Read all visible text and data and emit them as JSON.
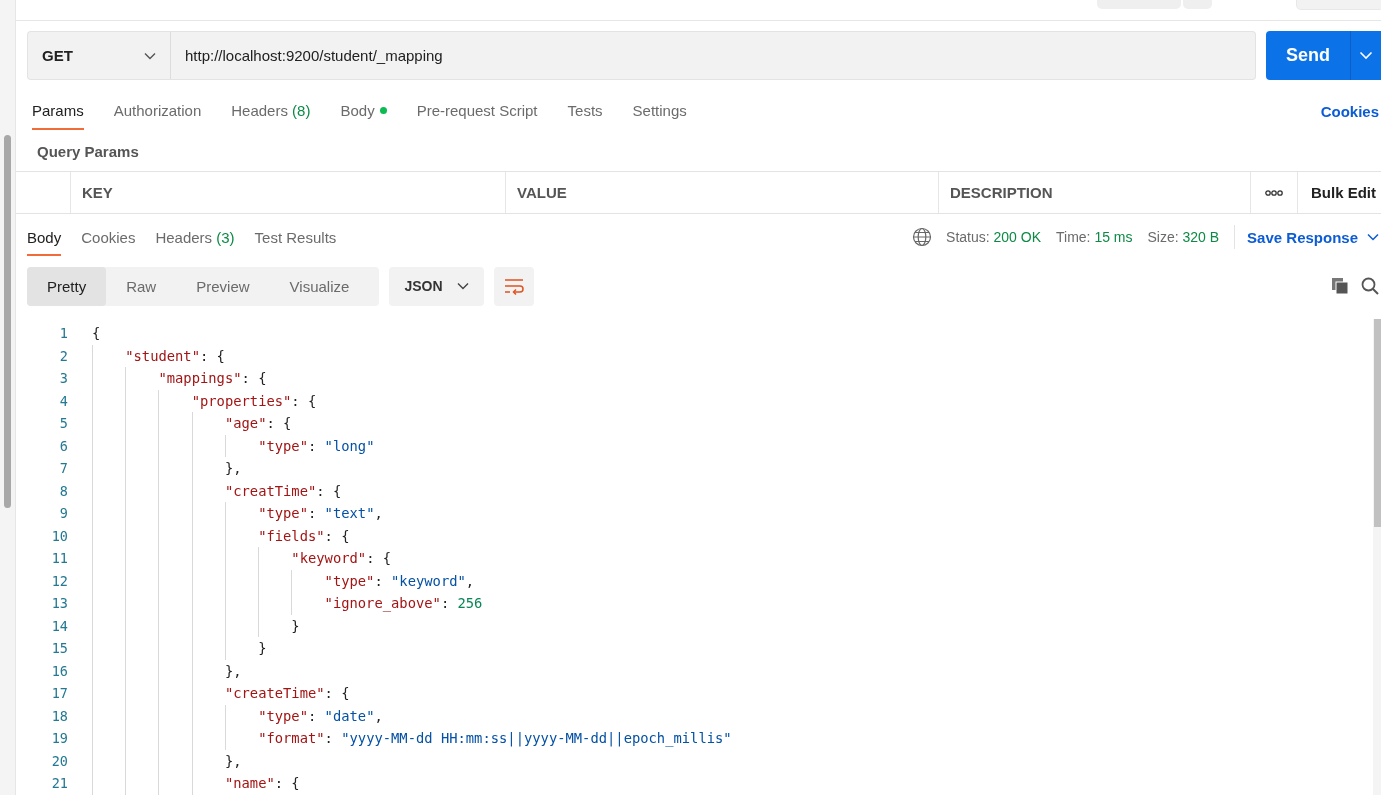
{
  "request": {
    "method": "GET",
    "url": "http://localhost:9200/student/_mapping",
    "send": "Send"
  },
  "request_tabs": [
    {
      "label": "Params",
      "selected": true
    },
    {
      "label": "Authorization",
      "selected": false
    },
    {
      "label": "Headers",
      "count": "(8)",
      "selected": false
    },
    {
      "label": "Body",
      "dot": true,
      "selected": false
    },
    {
      "label": "Pre-request Script",
      "selected": false
    },
    {
      "label": "Tests",
      "selected": false
    },
    {
      "label": "Settings",
      "selected": false
    }
  ],
  "cookies_link": "Cookies",
  "query_params": {
    "title": "Query Params",
    "columns": [
      "KEY",
      "VALUE",
      "DESCRIPTION"
    ],
    "bulk_edit": "Bulk Edit"
  },
  "response_tabs": [
    {
      "label": "Body",
      "selected": true
    },
    {
      "label": "Cookies",
      "selected": false
    },
    {
      "label": "Headers",
      "count": "(3)",
      "selected": false
    },
    {
      "label": "Test Results",
      "selected": false
    }
  ],
  "response_meta": [
    {
      "label": "Status:",
      "value": "200 OK"
    },
    {
      "label": "Time:",
      "value": "15 ms"
    },
    {
      "label": "Size:",
      "value": "320 B"
    }
  ],
  "save_response": "Save Response",
  "view_modes": [
    {
      "label": "Pretty",
      "selected": true
    },
    {
      "label": "Raw",
      "selected": false
    },
    {
      "label": "Preview",
      "selected": false
    },
    {
      "label": "Visualize",
      "selected": false
    }
  ],
  "format": "JSON",
  "code": [
    {
      "number": "1",
      "tokens": [
        {
          "kind": "punct",
          "text": "{"
        }
      ]
    },
    {
      "number": "2",
      "tokens": [
        {
          "kind": "key",
          "text": "    \"student\""
        },
        {
          "kind": "punct",
          "text": ": {"
        }
      ]
    },
    {
      "number": "3",
      "tokens": [
        {
          "kind": "key",
          "text": "        \"mappings\""
        },
        {
          "kind": "punct",
          "text": ": {"
        }
      ]
    },
    {
      "number": "4",
      "tokens": [
        {
          "kind": "key",
          "text": "            \"properties\""
        },
        {
          "kind": "punct",
          "text": ": {"
        }
      ]
    },
    {
      "number": "5",
      "tokens": [
        {
          "kind": "key",
          "text": "                \"age\""
        },
        {
          "kind": "punct",
          "text": ": {"
        }
      ]
    },
    {
      "number": "6",
      "tokens": [
        {
          "kind": "key",
          "text": "                    \"type\""
        },
        {
          "kind": "punct",
          "text": ": "
        },
        {
          "kind": "string",
          "text": "\"long\""
        }
      ]
    },
    {
      "number": "7",
      "tokens": [
        {
          "kind": "punct",
          "text": "                },"
        }
      ]
    },
    {
      "number": "8",
      "tokens": [
        {
          "kind": "key",
          "text": "                \"creatTime\""
        },
        {
          "kind": "punct",
          "text": ": {"
        }
      ]
    },
    {
      "number": "9",
      "tokens": [
        {
          "kind": "key",
          "text": "                    \"type\""
        },
        {
          "kind": "punct",
          "text": ": "
        },
        {
          "kind": "string",
          "text": "\"text\""
        },
        {
          "kind": "punct",
          "text": ","
        }
      ]
    },
    {
      "number": "10",
      "tokens": [
        {
          "kind": "key",
          "text": "                    \"fields\""
        },
        {
          "kind": "punct",
          "text": ": {"
        }
      ]
    },
    {
      "number": "11",
      "tokens": [
        {
          "kind": "key",
          "text": "                        \"keyword\""
        },
        {
          "kind": "punct",
          "text": ": {"
        }
      ]
    },
    {
      "number": "12",
      "tokens": [
        {
          "kind": "key",
          "text": "                            \"type\""
        },
        {
          "kind": "punct",
          "text": ": "
        },
        {
          "kind": "string",
          "text": "\"keyword\""
        },
        {
          "kind": "punct",
          "text": ","
        }
      ]
    },
    {
      "number": "13",
      "tokens": [
        {
          "kind": "key",
          "text": "                            \"ignore_above\""
        },
        {
          "kind": "punct",
          "text": ": "
        },
        {
          "kind": "number",
          "text": "256"
        }
      ]
    },
    {
      "number": "14",
      "tokens": [
        {
          "kind": "punct",
          "text": "                        }"
        }
      ]
    },
    {
      "number": "15",
      "tokens": [
        {
          "kind": "punct",
          "text": "                    }"
        }
      ]
    },
    {
      "number": "16",
      "tokens": [
        {
          "kind": "punct",
          "text": "                },"
        }
      ]
    },
    {
      "number": "17",
      "tokens": [
        {
          "kind": "key",
          "text": "                \"createTime\""
        },
        {
          "kind": "punct",
          "text": ": {"
        }
      ]
    },
    {
      "number": "18",
      "tokens": [
        {
          "kind": "key",
          "text": "                    \"type\""
        },
        {
          "kind": "punct",
          "text": ": "
        },
        {
          "kind": "string",
          "text": "\"date\""
        },
        {
          "kind": "punct",
          "text": ","
        }
      ]
    },
    {
      "number": "19",
      "tokens": [
        {
          "kind": "key",
          "text": "                    \"format\""
        },
        {
          "kind": "punct",
          "text": ": "
        },
        {
          "kind": "string",
          "text": "\"yyyy-MM-dd HH:mm:ss||yyyy-MM-dd||epoch_millis\""
        }
      ]
    },
    {
      "number": "20",
      "tokens": [
        {
          "kind": "punct",
          "text": "                },"
        }
      ]
    },
    {
      "number": "21",
      "tokens": [
        {
          "kind": "key",
          "text": "                \"name\""
        },
        {
          "kind": "punct",
          "text": ": {"
        }
      ]
    }
  ]
}
